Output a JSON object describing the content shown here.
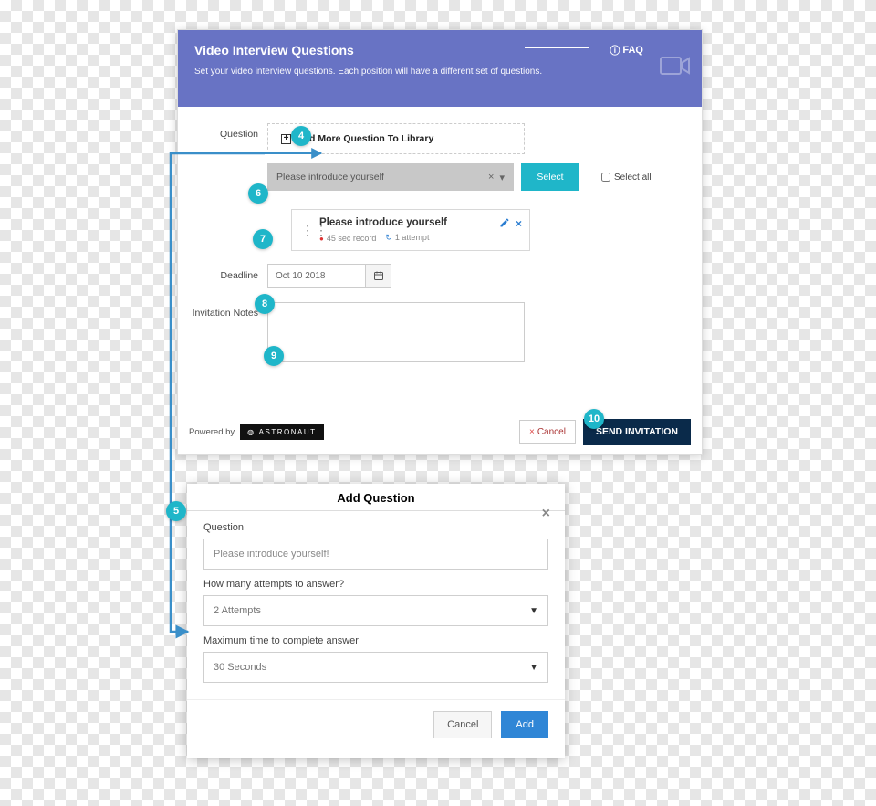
{
  "main": {
    "title": "Video Interview Questions",
    "subtitle": "Set your video interview questions. Each position will have a different set of questions.",
    "faq_label": "FAQ",
    "question_label": "Question",
    "add_library_label": "Add More Question To Library",
    "dropdown_value": "Please introduce yourself",
    "select_btn": "Select",
    "select_all_label": "Select all",
    "card": {
      "title": "Please introduce yourself",
      "record": "45 sec record",
      "attempt": "1 attempt"
    },
    "deadline_label": "Deadline",
    "deadline_value": "Oct 10 2018",
    "notes_label": "Invitation Notes",
    "powered_label": "Powered by",
    "powered_brand": "ASTRONAUT",
    "cancel_label": "Cancel",
    "send_label": "SEND INVITATION"
  },
  "modal": {
    "title": "Add Question",
    "q_label": "Question",
    "q_value": "Please introduce yourself!",
    "attempts_label": "How many attempts to answer?",
    "attempts_value": "2 Attempts",
    "maxtime_label": "Maximum time to complete answer",
    "maxtime_value": "30 Seconds",
    "cancel": "Cancel",
    "add": "Add"
  },
  "callouts": {
    "c4": "4",
    "c5": "5",
    "c6": "6",
    "c7": "7",
    "c8": "8",
    "c9": "9",
    "c10": "10"
  }
}
